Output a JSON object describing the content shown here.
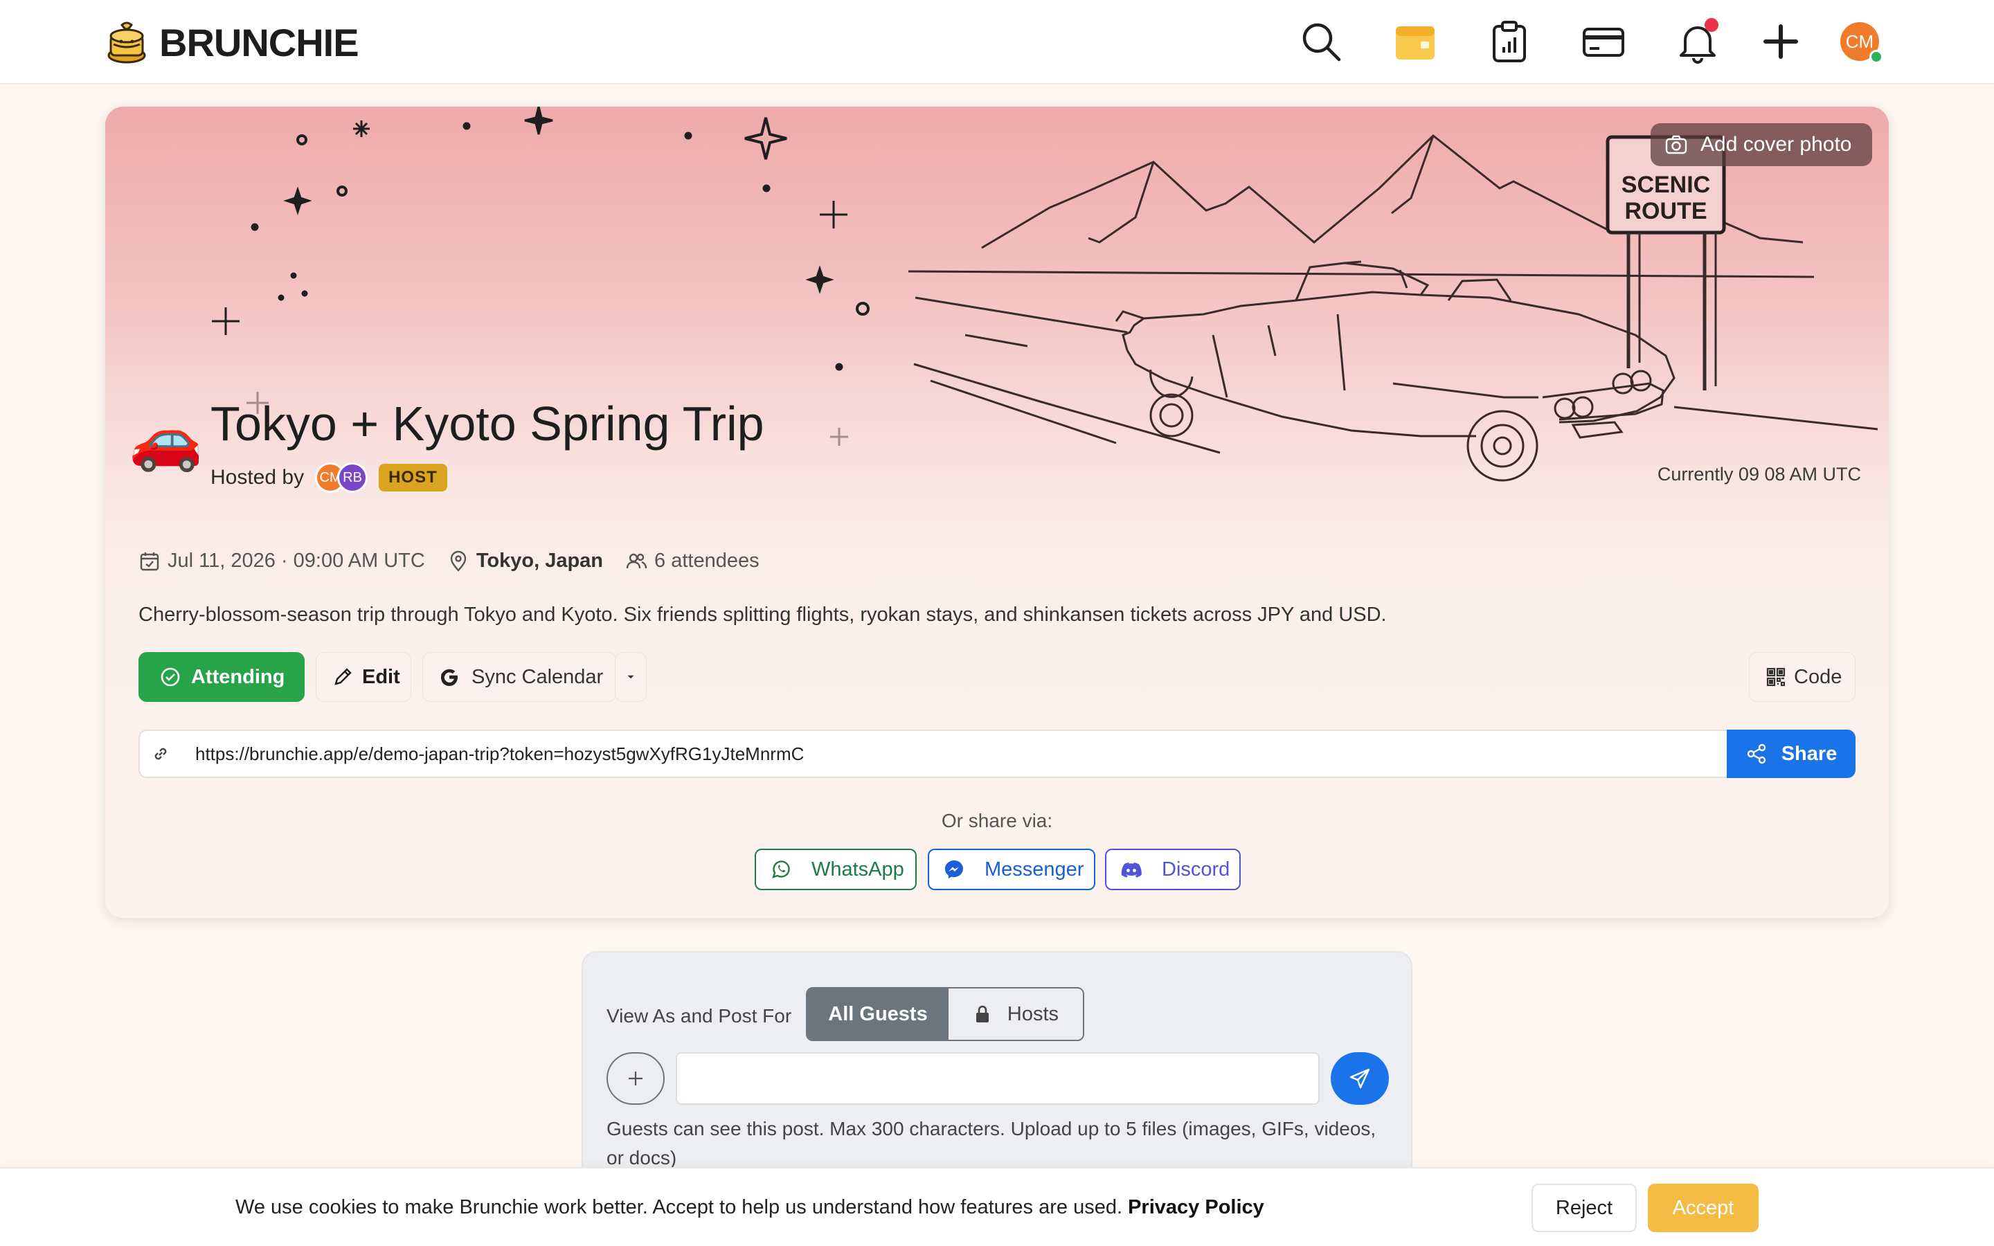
{
  "nav": {
    "brand": "BRUNCHIE",
    "avatar_initials": "CM",
    "icons": [
      "search-icon",
      "calendar-icon",
      "clipboard-chart-icon",
      "credit-card-icon",
      "bell-icon",
      "plus-icon"
    ],
    "accent": "#f5bc45"
  },
  "event": {
    "cover_button": "Add cover photo",
    "emoji": "🚗",
    "title": "Tokyo + Kyoto Spring Trip",
    "hosted_by_label": "Hosted by",
    "host_avatars": [
      {
        "initials": "CM",
        "color": "#f07b2b"
      },
      {
        "initials": "RB",
        "color": "#7a46c8"
      }
    ],
    "host_badge": "HOST",
    "current_time": "Currently 09 08 AM UTC",
    "date": "Jul 11, 2026 · 09:00 AM UTC",
    "location": "Tokyo, Japan",
    "attendees": "6 attendees",
    "description": "Cherry-blossom-season trip through Tokyo and Kyoto. Six friends splitting flights, ryokan stays, and shinkansen tickets across JPY and USD.",
    "sign_text_1": "SCENIC",
    "sign_text_2": "ROUTE"
  },
  "actions": {
    "attending": "Attending",
    "edit": "Edit",
    "sync_calendar": "Sync Calendar",
    "code": "Code",
    "share": "Share",
    "share_url": "https://brunchie.app/e/demo-japan-trip?token=hozyst5gwXyfRG1yJteMnrmC",
    "or_share_via": "Or share via:",
    "socials": {
      "whatsapp": "WhatsApp",
      "messenger": "Messenger",
      "discord": "Discord"
    },
    "attending_color": "#27a349",
    "share_color": "#1a73e8"
  },
  "composer": {
    "view_as_label": "View As and Post For",
    "tab_all": "All Guests",
    "tab_hosts": "Hosts",
    "input_value": "",
    "hint": "Guests can see this post.  Max 300 characters. Upload up to 5 files (images, GIFs, videos, or docs)"
  },
  "cookie": {
    "message": "We use cookies to make Brunchie work better. Accept to help us understand how features are used.",
    "policy_link": "Privacy Policy",
    "reject": "Reject",
    "accept": "Accept"
  }
}
